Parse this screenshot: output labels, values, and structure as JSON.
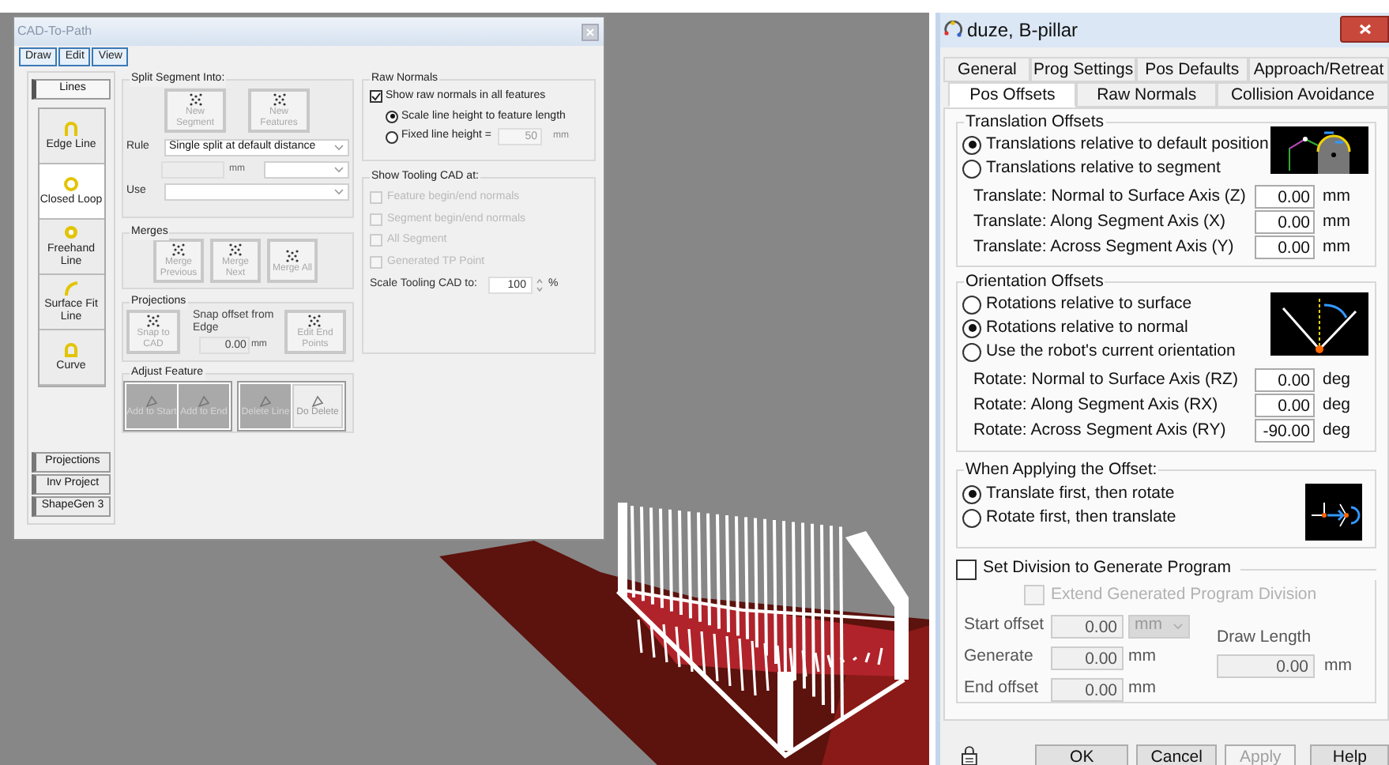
{
  "cad_to_path": {
    "title": "CAD-To-Path",
    "menu": [
      {
        "label": "Draw"
      },
      {
        "label": "Edit"
      },
      {
        "label": "View"
      }
    ],
    "side_tabs": [
      {
        "label": "Lines",
        "selected": true
      },
      {
        "label": "Projections",
        "selected": false
      },
      {
        "label": "Inv Project",
        "selected": false
      },
      {
        "label": "ShapeGen 3",
        "selected": false
      }
    ],
    "line_tools": [
      {
        "label": "Edge Line",
        "selected": false
      },
      {
        "label": "Closed Loop",
        "selected": true
      },
      {
        "label": "Freehand Line",
        "selected": false
      },
      {
        "label": "Surface Fit Line",
        "selected": false
      },
      {
        "label": "Curve",
        "selected": false
      }
    ],
    "split_segment": {
      "title": "Split Segment Into:",
      "buttons": [
        "New Segment",
        "New Features"
      ],
      "rule_label": "Rule",
      "rule_value": "Single split at default distance",
      "unit": "mm",
      "use_label": "Use"
    },
    "merges": {
      "title": "Merges",
      "buttons": [
        "Merge Previous",
        "Merge Next",
        "Merge All"
      ]
    },
    "projections": {
      "title": "Projections",
      "snap_button": "Snap to CAD",
      "snap_label": "Snap offset from Edge",
      "snap_value": "0.00",
      "unit": "mm",
      "edit_button": "Edit End Points"
    },
    "adjust_feature": {
      "title": "Adjust Feature",
      "buttons": [
        {
          "label": "Add to Start",
          "pressed": true
        },
        {
          "label": "Add to End",
          "pressed": true
        },
        {
          "label": "Delete Line",
          "pressed": true
        },
        {
          "label": "Do Delete",
          "pressed": false
        }
      ]
    },
    "raw_normals": {
      "title": "Raw Normals",
      "show_all": {
        "label": "Show raw normals in all features",
        "checked": true
      },
      "options": [
        {
          "label": "Scale line height to feature length",
          "selected": true
        },
        {
          "label": "Fixed line height =",
          "selected": false
        }
      ],
      "fixed_value": "50",
      "unit": "mm"
    },
    "tooling": {
      "title": "Show Tooling CAD at:",
      "options": [
        {
          "label": "Feature begin/end normals",
          "checked": false,
          "disabled": true
        },
        {
          "label": "Segment begin/end normals",
          "checked": false,
          "disabled": true
        },
        {
          "label": "All Segment",
          "checked": false,
          "disabled": true
        },
        {
          "label": "Generated TP Point",
          "checked": false,
          "disabled": true
        }
      ],
      "scale_label": "Scale Tooling CAD to:",
      "scale_value": "100",
      "unit": "%"
    }
  },
  "properties": {
    "title": "duze, B-pillar",
    "tab_rows": [
      [
        {
          "label": "General",
          "selected": false
        },
        {
          "label": "Prog Settings",
          "selected": false
        },
        {
          "label": "Pos Defaults",
          "selected": false
        },
        {
          "label": "Approach/Retreat",
          "selected": false
        }
      ],
      [
        {
          "label": "Pos Offsets",
          "selected": true
        },
        {
          "label": "Raw Normals",
          "selected": false
        },
        {
          "label": "Collision Avoidance",
          "selected": false
        }
      ]
    ],
    "translation": {
      "title": "Translation Offsets",
      "modes": [
        {
          "label": "Translations relative to default position",
          "selected": true
        },
        {
          "label": "Translations relative to segment",
          "selected": false
        }
      ],
      "fields": [
        {
          "label": "Translate: Normal to Surface Axis (Z)",
          "value": "0.00",
          "unit": "mm"
        },
        {
          "label": "Translate: Along Segment Axis (X)",
          "value": "0.00",
          "unit": "mm"
        },
        {
          "label": "Translate: Across Segment Axis (Y)",
          "value": "0.00",
          "unit": "mm"
        }
      ]
    },
    "orientation": {
      "title": "Orientation Offsets",
      "modes": [
        {
          "label": "Rotations relative to surface",
          "selected": false
        },
        {
          "label": "Rotations relative to normal",
          "selected": true
        },
        {
          "label": "Use the robot's current orientation",
          "selected": false
        }
      ],
      "fields": [
        {
          "label": "Rotate: Normal to Surface Axis (RZ)",
          "value": "0.00",
          "unit": "deg"
        },
        {
          "label": "Rotate: Along Segment Axis (RX)",
          "value": "0.00",
          "unit": "deg"
        },
        {
          "label": "Rotate: Across Segment Axis (RY)",
          "value": "-90.00",
          "unit": "deg"
        }
      ]
    },
    "order": {
      "title": "When Applying the Offset:",
      "options": [
        {
          "label": "Translate first, then rotate",
          "selected": true
        },
        {
          "label": "Rotate first, then translate",
          "selected": false
        }
      ]
    },
    "division": {
      "label": "Set Division to Generate Program",
      "checked": false,
      "extend": {
        "label": "Extend Generated Program Division",
        "checked": false
      },
      "start_label": "Start offset",
      "start_value": "0.00",
      "start_unit": "mm",
      "generate_label": "Generate",
      "generate_value": "0.00",
      "generate_unit": "mm",
      "end_label": "End offset",
      "end_value": "0.00",
      "end_unit": "mm",
      "draw_length_label": "Draw Length",
      "draw_length_value": "0.00",
      "draw_length_unit": "mm"
    },
    "buttons": [
      {
        "label": "OK",
        "disabled": false
      },
      {
        "label": "Cancel",
        "disabled": false
      },
      {
        "label": "Apply",
        "disabled": true
      },
      {
        "label": "Help",
        "disabled": false
      }
    ]
  }
}
